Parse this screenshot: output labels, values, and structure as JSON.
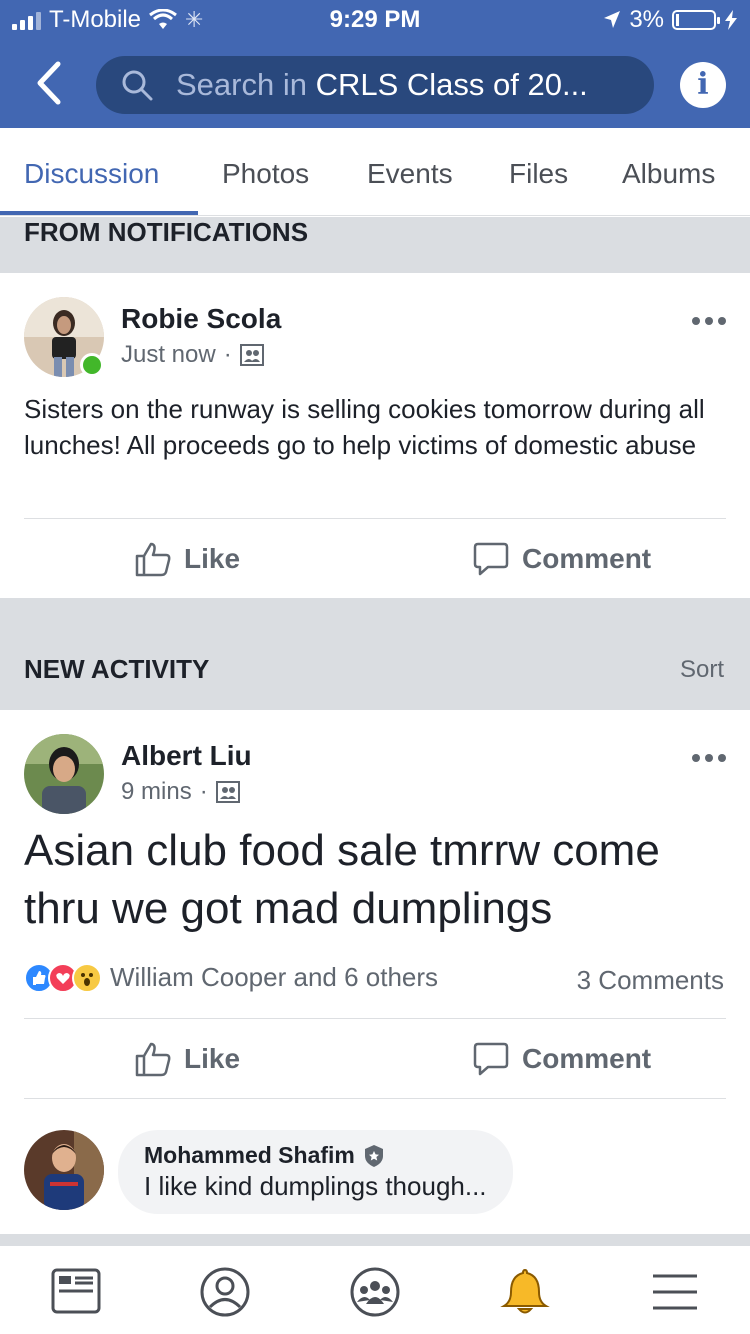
{
  "status": {
    "carrier": "T-Mobile",
    "time": "9:29 PM",
    "battery": "3%"
  },
  "header": {
    "search_prefix": "Search in ",
    "search_group": "CRLS Class of 20...",
    "info_label": "i"
  },
  "tabs": [
    {
      "label": "Discussion",
      "active": true
    },
    {
      "label": "Photos"
    },
    {
      "label": "Events"
    },
    {
      "label": "Files"
    },
    {
      "label": "Albums"
    }
  ],
  "from_notifications": {
    "title": "FROM NOTIFICATIONS"
  },
  "post1": {
    "author": "Robie Scola",
    "time": "Just now",
    "separator": "·",
    "text": "Sisters on the runway is selling cookies tomorrow during all lunches! All proceeds go to help victims of domestic abuse",
    "like_label": "Like",
    "comment_label": "Comment"
  },
  "new_activity": {
    "title": "NEW ACTIVITY",
    "sort_label": "Sort"
  },
  "post2": {
    "author": "Albert Liu",
    "time": "9 mins",
    "separator": "·",
    "text": "Asian club food sale tmrrw come thru we got mad dumplings",
    "reactions_text": "William Cooper and 6 others",
    "comments_count": "3 Comments",
    "like_label": "Like",
    "comment_label": "Comment"
  },
  "comment": {
    "name": "Mohammed Shafim",
    "text": "I like kind dumplings though..."
  },
  "colors": {
    "brand": "#4267b2",
    "online": "#42b72a"
  }
}
